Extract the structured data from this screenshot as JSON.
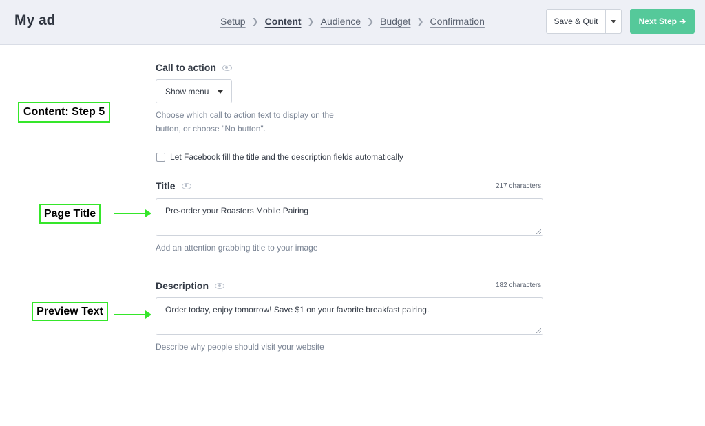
{
  "header": {
    "title": "My ad",
    "steps": [
      {
        "label": "Setup"
      },
      {
        "label": "Content"
      },
      {
        "label": "Audience"
      },
      {
        "label": "Budget"
      },
      {
        "label": "Confirmation"
      }
    ],
    "active_step": "Content",
    "save_quit_label": "Save & Quit",
    "next_step_label": "Next Step ➔"
  },
  "form": {
    "cta": {
      "label": "Call to action",
      "selected": "Show menu",
      "help_line1": "Choose which call to action text to display on the",
      "help_line2": "button, or choose \"No button\"."
    },
    "autofill_label": "Let Facebook fill the title and the description fields automatically",
    "title_field": {
      "label": "Title",
      "counter": "217 characters",
      "value": "Pre-order your Roasters Mobile Pairing",
      "help": "Add an attention grabbing title to your image"
    },
    "description_field": {
      "label": "Description",
      "counter": "182 characters",
      "value": "Order today, enjoy tomorrow!  Save $1 on your favorite breakfast pairing.",
      "help": "Describe why people should visit your website"
    }
  },
  "annotations": {
    "step": "Content: Step 5",
    "page_title": "Page Title",
    "preview_text": "Preview Text"
  },
  "colors": {
    "accent_green": "#55c99a",
    "annotation_green": "#35e62a",
    "header_bg": "#eef0f6"
  }
}
